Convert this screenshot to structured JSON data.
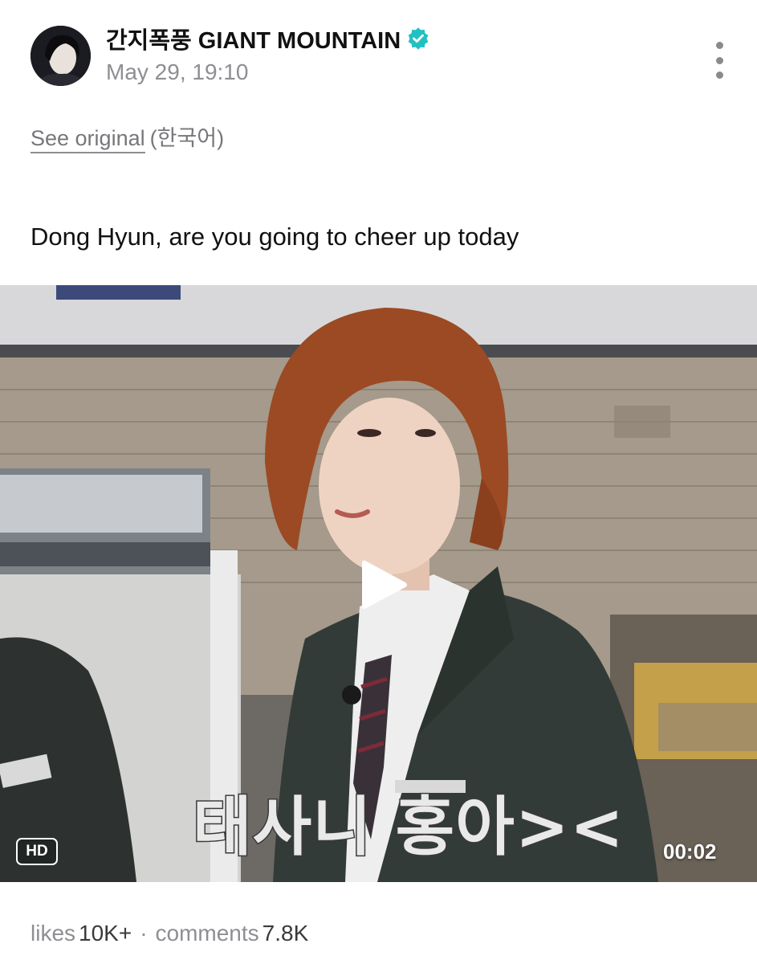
{
  "post": {
    "author": "간지폭풍 GIANT MOUNTAIN",
    "verified_icon": "verified-badge-icon",
    "timestamp": "May 29, 19:10",
    "menu_icon": "more-vertical-icon",
    "see_original": "See original",
    "original_language": "(한국어)",
    "caption": "Dong Hyun, are you going to cheer up today"
  },
  "video": {
    "subtitle": "태사니 홍아><",
    "quality_badge": "HD",
    "duration": "00:02",
    "play_icon": "play-icon"
  },
  "stats": {
    "likes_label": "likes",
    "likes_value": "10K+",
    "separator": "·",
    "comments_label": "comments",
    "comments_value": "7.8K"
  },
  "colors": {
    "verified": "#21c1c1",
    "text_primary": "#111111",
    "text_secondary": "#8e8e93"
  }
}
